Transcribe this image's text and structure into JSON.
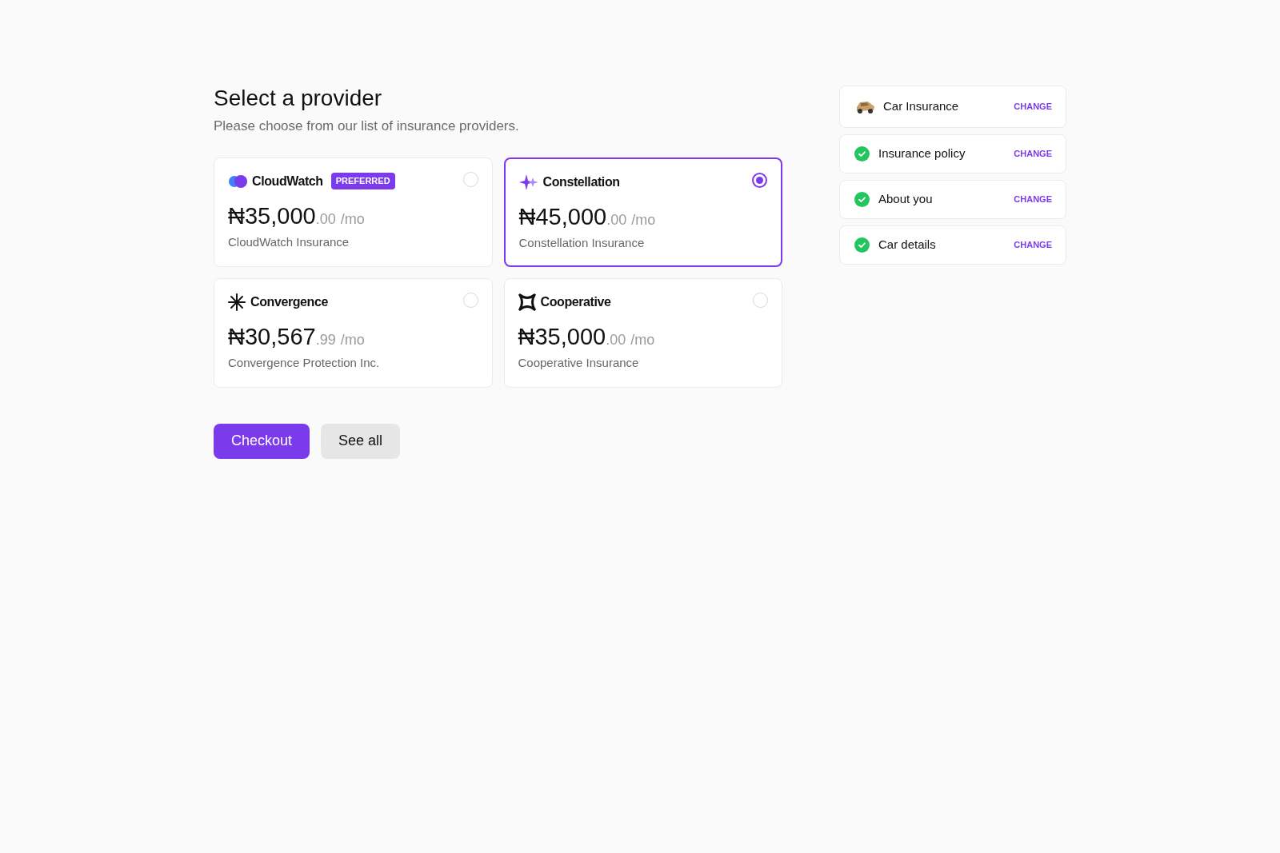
{
  "header": {
    "title": "Select a provider",
    "subtitle": "Please choose from our list of insurance providers."
  },
  "providers": [
    {
      "kind": "cloud",
      "logo_text": "CloudWatch",
      "badge": "PREFERRED",
      "price": "₦35,000",
      "cents": ".00",
      "period": "/mo",
      "name": "CloudWatch Insurance",
      "selected": false
    },
    {
      "kind": "sparkle",
      "logo_text": "Constellation",
      "price": "₦45,000",
      "cents": ".00",
      "period": "/mo",
      "name": "Constellation Insurance",
      "selected": true
    },
    {
      "kind": "starburst",
      "logo_text": "Convergence",
      "price": "₦30,567",
      "cents": ".99",
      "period": "/mo",
      "name": "Convergence Protection Inc.",
      "selected": false
    },
    {
      "kind": "brackets",
      "logo_text": "Cooperative",
      "price": "₦35,000",
      "cents": ".00",
      "period": "/mo",
      "name": "Cooperative Insurance",
      "selected": false
    }
  ],
  "actions": [
    {
      "kind": "primary",
      "label": "Checkout"
    },
    {
      "kind": "secondary",
      "label": "See all"
    }
  ],
  "steps": [
    {
      "kind": "car",
      "label": "Car Insurance",
      "action": "CHANGE"
    },
    {
      "kind": "done",
      "label": "Insurance policy",
      "action": "CHANGE"
    },
    {
      "kind": "done",
      "label": "About you",
      "action": "CHANGE"
    },
    {
      "kind": "done",
      "label": "Car details",
      "action": "CHANGE"
    }
  ]
}
